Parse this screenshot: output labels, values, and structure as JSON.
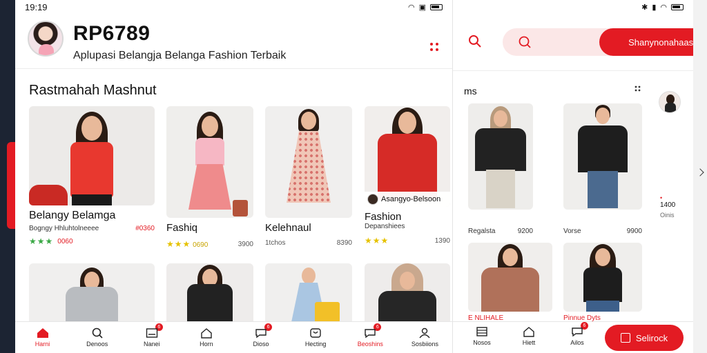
{
  "left": {
    "status": {
      "time": "19:19"
    },
    "header": {
      "title": "RP6789",
      "subtitle": "Aplupasi Belangja  Belanga  Fashion Terbaik"
    },
    "section_title": "Rastmahah Mashnut",
    "products_row1": [
      {
        "name": "Belangy  Belamga",
        "meta": "Bogngy Hhluhtolneeee",
        "price": "#0360",
        "stars": "★★★",
        "rating": "0060"
      },
      {
        "name": "Fashiq",
        "stars": "★★★",
        "rating": "0690",
        "count": "3900"
      },
      {
        "name": "Kelehnaul",
        "meta2": "1tchos",
        "count": "8390"
      },
      {
        "name": "Fashion",
        "badge": "Asangyo-Belsoon",
        "meta": "Depanshiees",
        "stars": "★★★",
        "count": "1390"
      }
    ],
    "nav": [
      {
        "label": "Harni",
        "active": true
      },
      {
        "label": "Denoos"
      },
      {
        "label": "Nanei",
        "badge": "6"
      },
      {
        "label": "Horn"
      },
      {
        "label": "Dioso",
        "badge": "6"
      },
      {
        "label": "Hecting"
      },
      {
        "label": "Beoshins",
        "badge": "6",
        "active": true
      },
      {
        "label": "Sosbiions"
      }
    ]
  },
  "right": {
    "search_button": "Shanynonahaaseit",
    "section_title": "ms",
    "labels": [
      {
        "name": "Regalsta",
        "value": "9200"
      },
      {
        "name": "Vorse",
        "value": "9900"
      }
    ],
    "bottom_labels": [
      "E NLIHALE",
      "Pinnue Dyts"
    ],
    "side_stat": {
      "value": "1400",
      "sub": "Oinis"
    },
    "nav": [
      {
        "label": "Nosos"
      },
      {
        "label": "Hiett"
      },
      {
        "label": "Ailos",
        "badge": "6"
      }
    ],
    "cta": "Selirock"
  },
  "colors": {
    "accent": "#e31b23",
    "star": "#e6c200"
  }
}
